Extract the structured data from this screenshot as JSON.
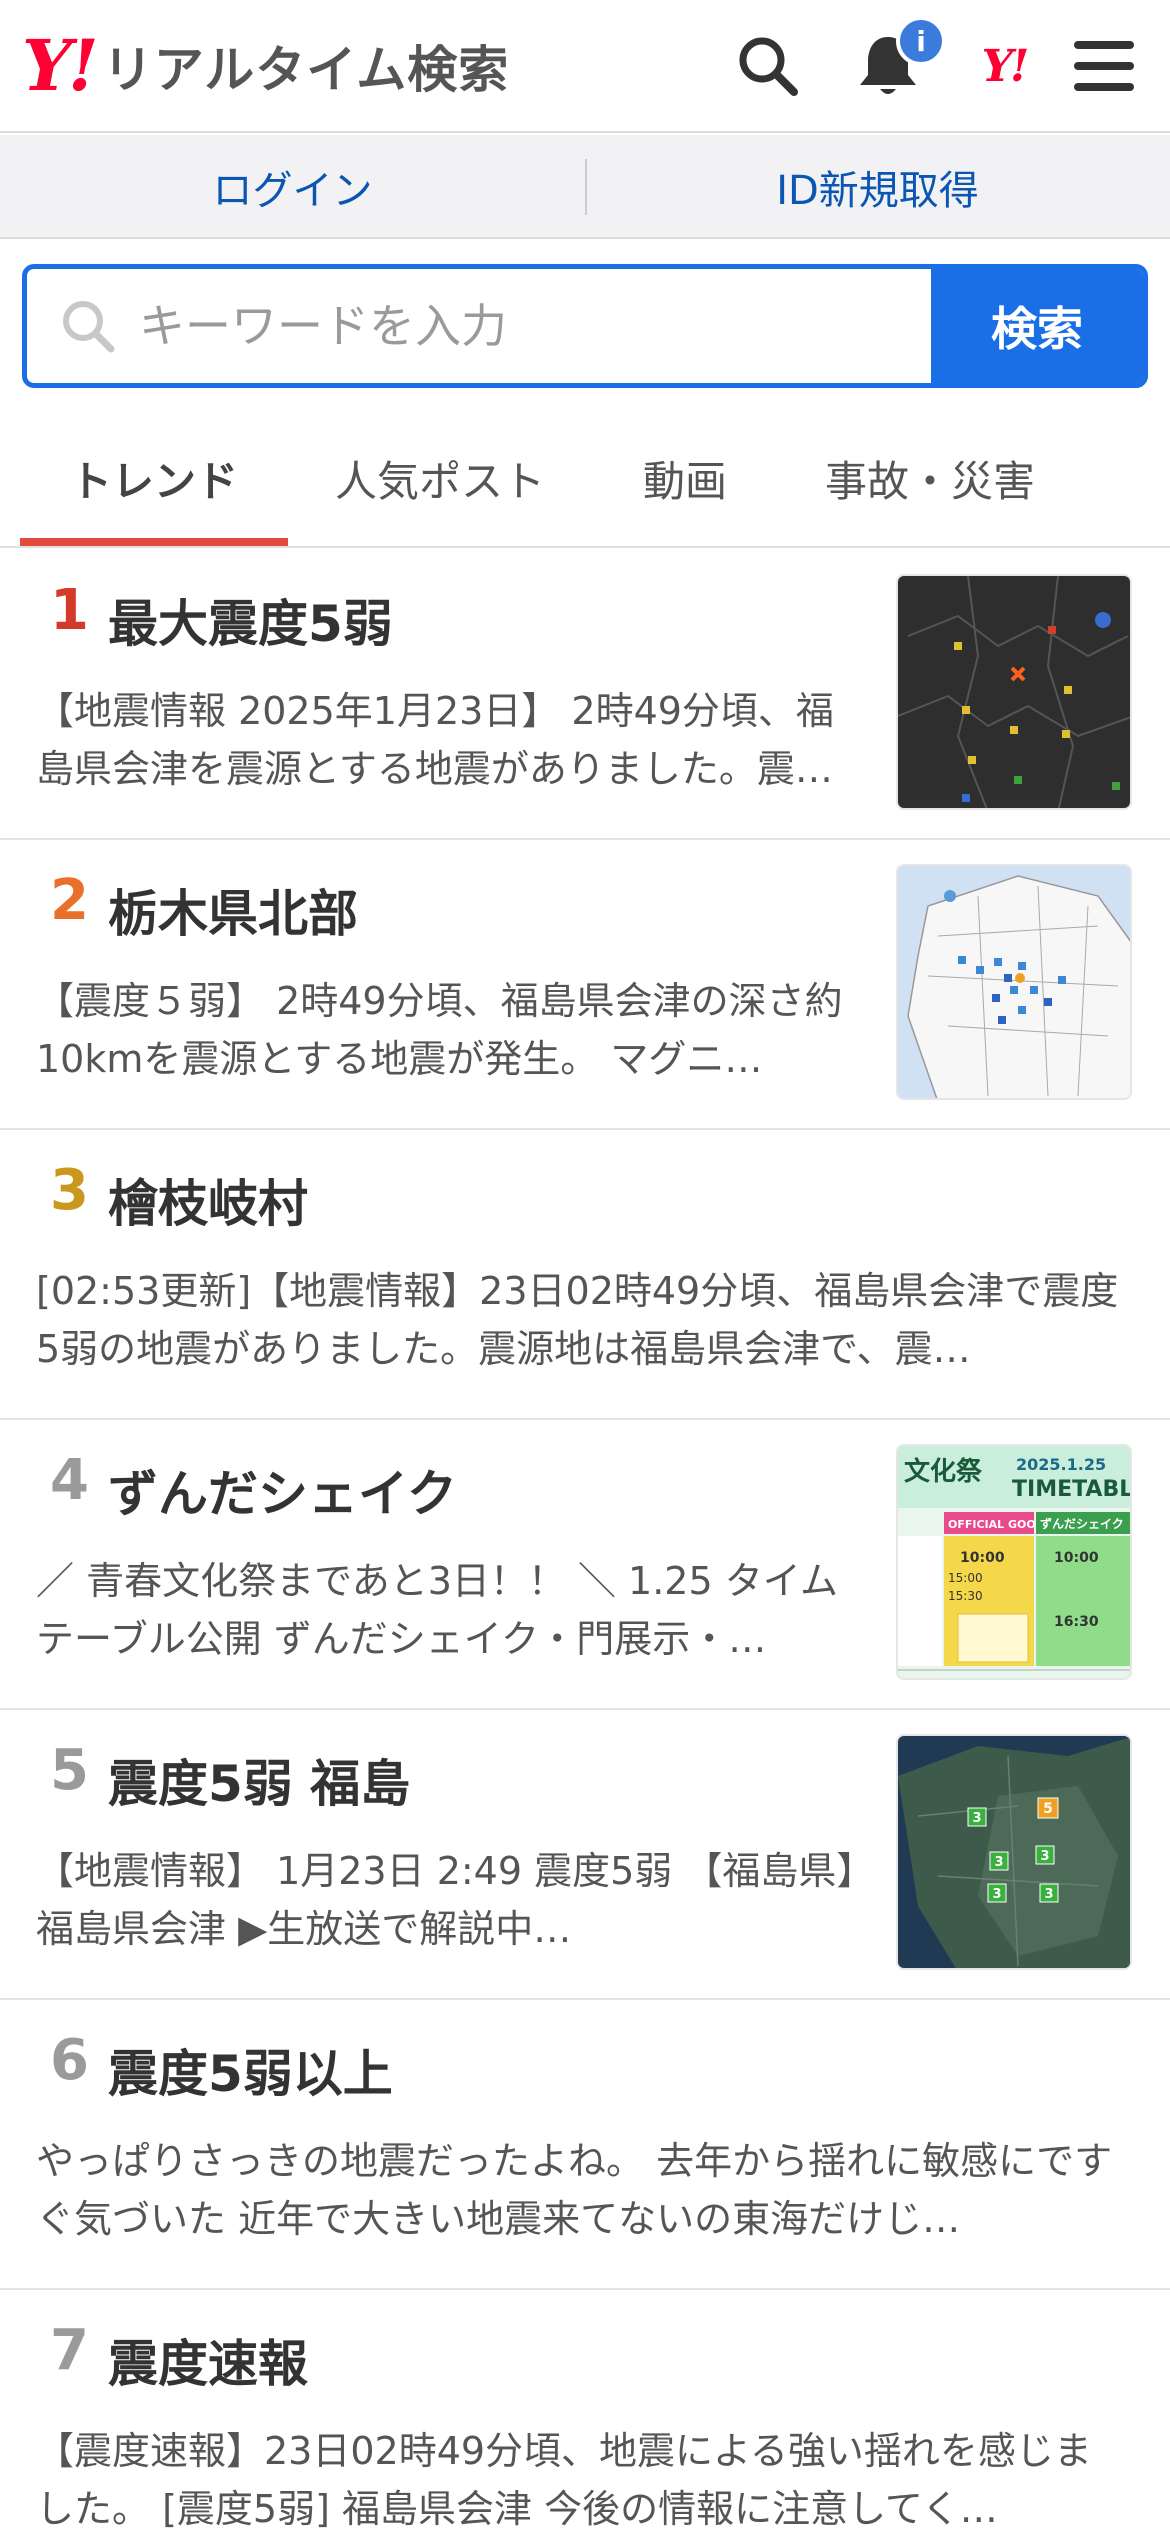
{
  "header": {
    "logo_mark": "Y!",
    "logo_text": "リアルタイム検索",
    "notification_count": "i",
    "yj_mark": "Y!"
  },
  "login": {
    "login_label": "ログイン",
    "register_label": "ID新規取得"
  },
  "search": {
    "placeholder": "キーワードを入力",
    "button_label": "検索"
  },
  "tabs": [
    {
      "label": "トレンド",
      "active": true
    },
    {
      "label": "人気ポスト",
      "active": false
    },
    {
      "label": "動画",
      "active": false
    },
    {
      "label": "事故・災害",
      "active": false
    }
  ],
  "colors": {
    "brand_red": "#ff0033",
    "link_blue": "#0b55b3",
    "search_blue": "#1a6fe6",
    "tab_underline": "#e24b3b",
    "rank1": "#d23a2a",
    "rank2": "#e8702a",
    "rank3": "#c9981c",
    "rank_other": "#9a9a9a"
  },
  "trends": [
    {
      "rank": "1",
      "title": "最大震度5弱",
      "desc": "【地震情報 2025年1月23日】 2時49分頃、福島県会津を震源とする地震がありました。震…",
      "thumb": "dark-map"
    },
    {
      "rank": "2",
      "title": "栃木県北部",
      "desc": "【震度５弱】 2時49分頃、福島県会津の深さ約10kmを震源とする地震が発生。 マグニ…",
      "thumb": "white-map"
    },
    {
      "rank": "3",
      "title": "檜枝岐村",
      "desc": "[02:53更新]【地震情報】23日02時49分頃、福島県会津で震度5弱の地震がありました。震源地は福島県会津で、震…",
      "thumb": ""
    },
    {
      "rank": "4",
      "title": "ずんだシェイク",
      "desc": "／ 青春文化祭まであと3日！！ ＼ 1.25 タイムテーブル公開 ずんだシェイク・門展示・…",
      "thumb": "timetable"
    },
    {
      "rank": "5",
      "title": "震度5弱 福島",
      "desc": "【地震情報】 1月23日 2:49 震度5弱 【福島県】福島県会津 ▶生放送で解説中…",
      "thumb": "satellite-map"
    },
    {
      "rank": "6",
      "title": "震度5弱以上",
      "desc": "やっぱりさっきの地震だったよね。 去年から揺れに敏感にですぐ気づいた 近年で大きい地震来てないの東海だけじ…",
      "thumb": ""
    },
    {
      "rank": "7",
      "title": "震度速報",
      "desc": "【震度速報】23日02時49分頃、地震による強い揺れを感じました。 [震度5弱] 福島県会津 今後の情報に注意してく…",
      "thumb": ""
    }
  ],
  "thumb_text": {
    "timetable_banner": "文化祭",
    "timetable_date": "2025.1.25",
    "timetable_title": "TIMETABLE",
    "timetable_goods": "OFFICIAL GOODS",
    "timetable_shake": "ずんだシェイク",
    "timetable_t1": "10:00",
    "timetable_t2": "15:00",
    "timetable_t3": "15:30",
    "timetable_t4": "10:00",
    "timetable_t5": "16:30",
    "sat_mark_5": "5",
    "sat_mark_3": "3"
  }
}
